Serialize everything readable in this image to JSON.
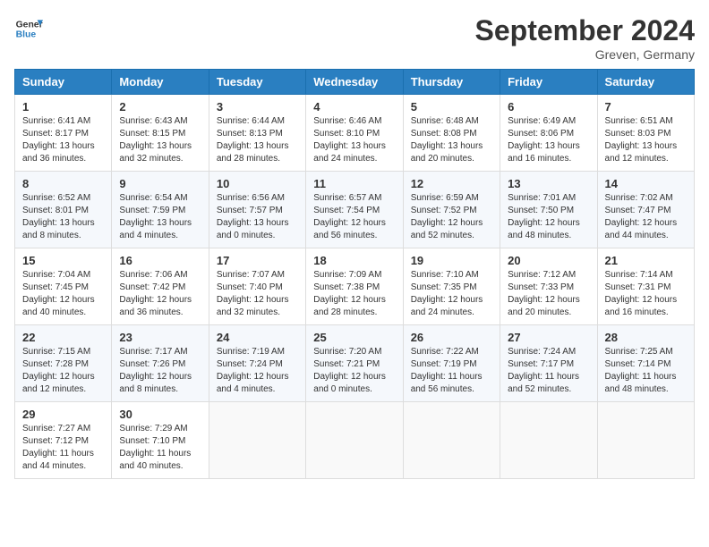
{
  "logo": {
    "line1": "General",
    "line2": "Blue"
  },
  "title": "September 2024",
  "location": "Greven, Germany",
  "headers": [
    "Sunday",
    "Monday",
    "Tuesday",
    "Wednesday",
    "Thursday",
    "Friday",
    "Saturday"
  ],
  "weeks": [
    [
      {
        "day": "1",
        "sunrise": "6:41 AM",
        "sunset": "8:17 PM",
        "daylight": "13 hours and 36 minutes."
      },
      {
        "day": "2",
        "sunrise": "6:43 AM",
        "sunset": "8:15 PM",
        "daylight": "13 hours and 32 minutes."
      },
      {
        "day": "3",
        "sunrise": "6:44 AM",
        "sunset": "8:13 PM",
        "daylight": "13 hours and 28 minutes."
      },
      {
        "day": "4",
        "sunrise": "6:46 AM",
        "sunset": "8:10 PM",
        "daylight": "13 hours and 24 minutes."
      },
      {
        "day": "5",
        "sunrise": "6:48 AM",
        "sunset": "8:08 PM",
        "daylight": "13 hours and 20 minutes."
      },
      {
        "day": "6",
        "sunrise": "6:49 AM",
        "sunset": "8:06 PM",
        "daylight": "13 hours and 16 minutes."
      },
      {
        "day": "7",
        "sunrise": "6:51 AM",
        "sunset": "8:03 PM",
        "daylight": "13 hours and 12 minutes."
      }
    ],
    [
      {
        "day": "8",
        "sunrise": "6:52 AM",
        "sunset": "8:01 PM",
        "daylight": "13 hours and 8 minutes."
      },
      {
        "day": "9",
        "sunrise": "6:54 AM",
        "sunset": "7:59 PM",
        "daylight": "13 hours and 4 minutes."
      },
      {
        "day": "10",
        "sunrise": "6:56 AM",
        "sunset": "7:57 PM",
        "daylight": "13 hours and 0 minutes."
      },
      {
        "day": "11",
        "sunrise": "6:57 AM",
        "sunset": "7:54 PM",
        "daylight": "12 hours and 56 minutes."
      },
      {
        "day": "12",
        "sunrise": "6:59 AM",
        "sunset": "7:52 PM",
        "daylight": "12 hours and 52 minutes."
      },
      {
        "day": "13",
        "sunrise": "7:01 AM",
        "sunset": "7:50 PM",
        "daylight": "12 hours and 48 minutes."
      },
      {
        "day": "14",
        "sunrise": "7:02 AM",
        "sunset": "7:47 PM",
        "daylight": "12 hours and 44 minutes."
      }
    ],
    [
      {
        "day": "15",
        "sunrise": "7:04 AM",
        "sunset": "7:45 PM",
        "daylight": "12 hours and 40 minutes."
      },
      {
        "day": "16",
        "sunrise": "7:06 AM",
        "sunset": "7:42 PM",
        "daylight": "12 hours and 36 minutes."
      },
      {
        "day": "17",
        "sunrise": "7:07 AM",
        "sunset": "7:40 PM",
        "daylight": "12 hours and 32 minutes."
      },
      {
        "day": "18",
        "sunrise": "7:09 AM",
        "sunset": "7:38 PM",
        "daylight": "12 hours and 28 minutes."
      },
      {
        "day": "19",
        "sunrise": "7:10 AM",
        "sunset": "7:35 PM",
        "daylight": "12 hours and 24 minutes."
      },
      {
        "day": "20",
        "sunrise": "7:12 AM",
        "sunset": "7:33 PM",
        "daylight": "12 hours and 20 minutes."
      },
      {
        "day": "21",
        "sunrise": "7:14 AM",
        "sunset": "7:31 PM",
        "daylight": "12 hours and 16 minutes."
      }
    ],
    [
      {
        "day": "22",
        "sunrise": "7:15 AM",
        "sunset": "7:28 PM",
        "daylight": "12 hours and 12 minutes."
      },
      {
        "day": "23",
        "sunrise": "7:17 AM",
        "sunset": "7:26 PM",
        "daylight": "12 hours and 8 minutes."
      },
      {
        "day": "24",
        "sunrise": "7:19 AM",
        "sunset": "7:24 PM",
        "daylight": "12 hours and 4 minutes."
      },
      {
        "day": "25",
        "sunrise": "7:20 AM",
        "sunset": "7:21 PM",
        "daylight": "12 hours and 0 minutes."
      },
      {
        "day": "26",
        "sunrise": "7:22 AM",
        "sunset": "7:19 PM",
        "daylight": "11 hours and 56 minutes."
      },
      {
        "day": "27",
        "sunrise": "7:24 AM",
        "sunset": "7:17 PM",
        "daylight": "11 hours and 52 minutes."
      },
      {
        "day": "28",
        "sunrise": "7:25 AM",
        "sunset": "7:14 PM",
        "daylight": "11 hours and 48 minutes."
      }
    ],
    [
      {
        "day": "29",
        "sunrise": "7:27 AM",
        "sunset": "7:12 PM",
        "daylight": "11 hours and 44 minutes."
      },
      {
        "day": "30",
        "sunrise": "7:29 AM",
        "sunset": "7:10 PM",
        "daylight": "11 hours and 40 minutes."
      },
      null,
      null,
      null,
      null,
      null
    ]
  ],
  "labels": {
    "sunrise_prefix": "Sunrise: ",
    "sunset_prefix": "Sunset: ",
    "daylight_prefix": "Daylight: "
  }
}
